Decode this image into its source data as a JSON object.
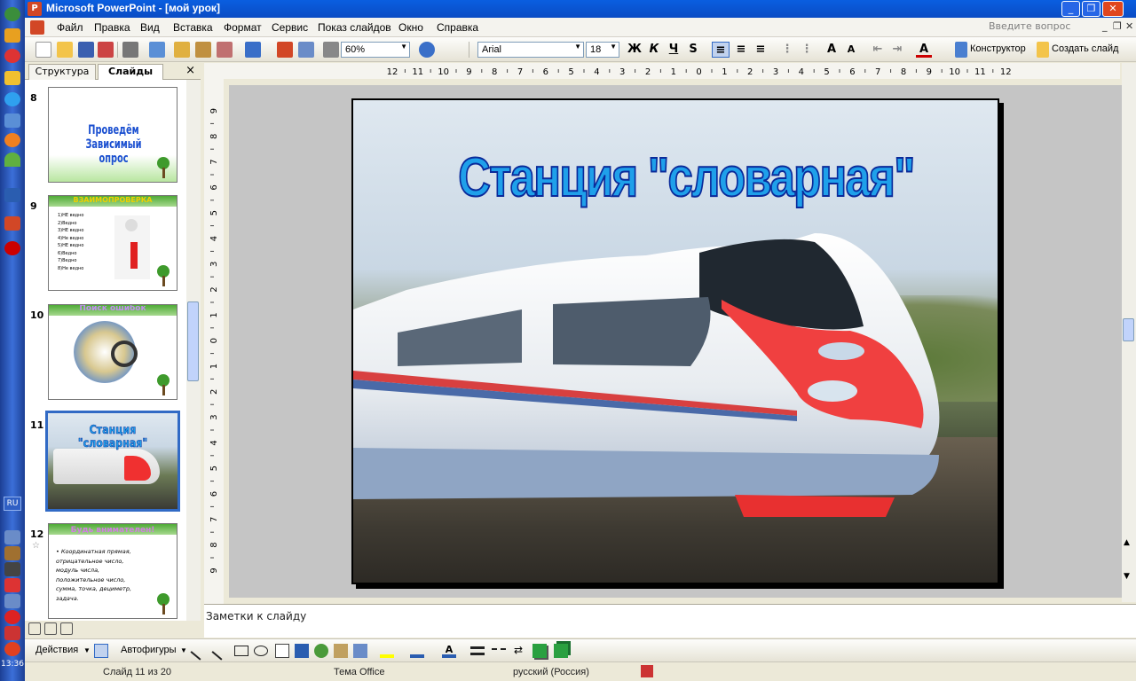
{
  "window": {
    "title": "Microsoft PowerPoint - [мой урок]"
  },
  "menu": {
    "items": [
      "Файл",
      "Правка",
      "Вид",
      "Вставка",
      "Формат",
      "Сервис",
      "Показ слайдов",
      "Окно",
      "Справка"
    ],
    "ask_placeholder": "Введите вопрос"
  },
  "toolbar": {
    "zoom": "60%",
    "font": "Arial",
    "size": "18",
    "bold": "Ж",
    "italic": "К",
    "underline": "Ч",
    "shadow": "S",
    "designer": "Конструктор",
    "new_slide": "Создать слайд"
  },
  "pane": {
    "tab_outline": "Структура",
    "tab_slides": "Слайды",
    "close": "×",
    "thumbnails": [
      {
        "num": "8",
        "title": "Проведём Зависимый опрос"
      },
      {
        "num": "9",
        "title": "ВЗАИМОПРОВЕРКА",
        "lines": [
          "1)НЕ ведно",
          "2)Ведно",
          "3)НЕ ведно",
          "4)Не ведно",
          "5)НЕ ведно",
          "6)Ведно",
          "7)Ведно",
          "8)Не ведно"
        ]
      },
      {
        "num": "10",
        "title": "Поиск ошибок"
      },
      {
        "num": "11",
        "title": "Станция \"словарная\""
      },
      {
        "num": "12",
        "title": "Будь внимателен!",
        "lines": [
          "• Координатная прямая, отрицательное число, модуль числа, положительное число, сумма, точка, дециметр, задача."
        ]
      }
    ]
  },
  "ruler": {
    "h_marks": [
      "12",
      "11",
      "10",
      "9",
      "8",
      "7",
      "6",
      "5",
      "4",
      "3",
      "2",
      "1",
      "0",
      "1",
      "2",
      "3",
      "4",
      "5",
      "6",
      "7",
      "8",
      "9",
      "10",
      "11",
      "12"
    ],
    "v_marks": [
      "9",
      "8",
      "7",
      "6",
      "5",
      "4",
      "3",
      "2",
      "1",
      "0",
      "1",
      "2",
      "3",
      "4",
      "5",
      "6",
      "7",
      "8",
      "9"
    ]
  },
  "slide": {
    "title": "Станция \"словарная\""
  },
  "notes": {
    "placeholder": "Заметки к слайду"
  },
  "drawing": {
    "actions": "Действия",
    "autoshapes": "Автофигуры"
  },
  "status": {
    "slide": "Слайд 11 из 20",
    "theme": "Тема Office",
    "language": "русский (Россия)"
  },
  "taskbar": {
    "lang": "RU",
    "clock": "13:36"
  },
  "colors": {
    "title_blue": "#0a4cc4",
    "wordart": "#1fa0ea",
    "train_red": "#f03030",
    "accent": "#316ac5"
  }
}
